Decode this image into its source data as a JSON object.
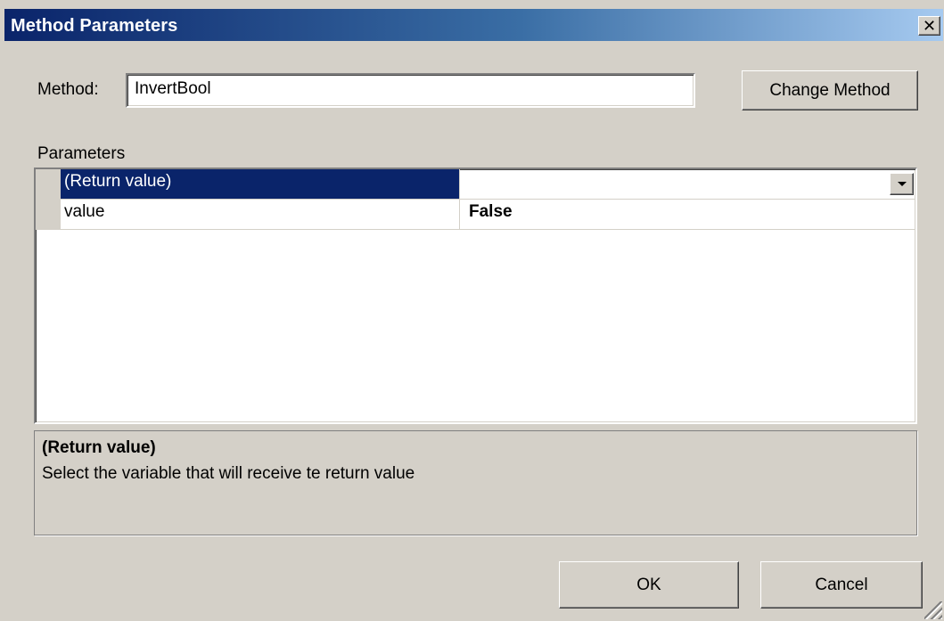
{
  "window": {
    "title": "Method Parameters",
    "close_label": "✕"
  },
  "method": {
    "label": "Method:",
    "value": "InvertBool",
    "change_button": "Change Method"
  },
  "parameters": {
    "group_label": "Parameters",
    "rows": [
      {
        "name": "(Return value)",
        "value": "",
        "selected": true,
        "has_dropdown": true
      },
      {
        "name": "value",
        "value": "False",
        "selected": false,
        "has_dropdown": false
      }
    ]
  },
  "description": {
    "title": "(Return value)",
    "text": "Select the variable that will receive te return value"
  },
  "buttons": {
    "ok": "OK",
    "cancel": "Cancel"
  },
  "colors": {
    "selection": "#0a246a",
    "face": "#d4d0c8"
  }
}
